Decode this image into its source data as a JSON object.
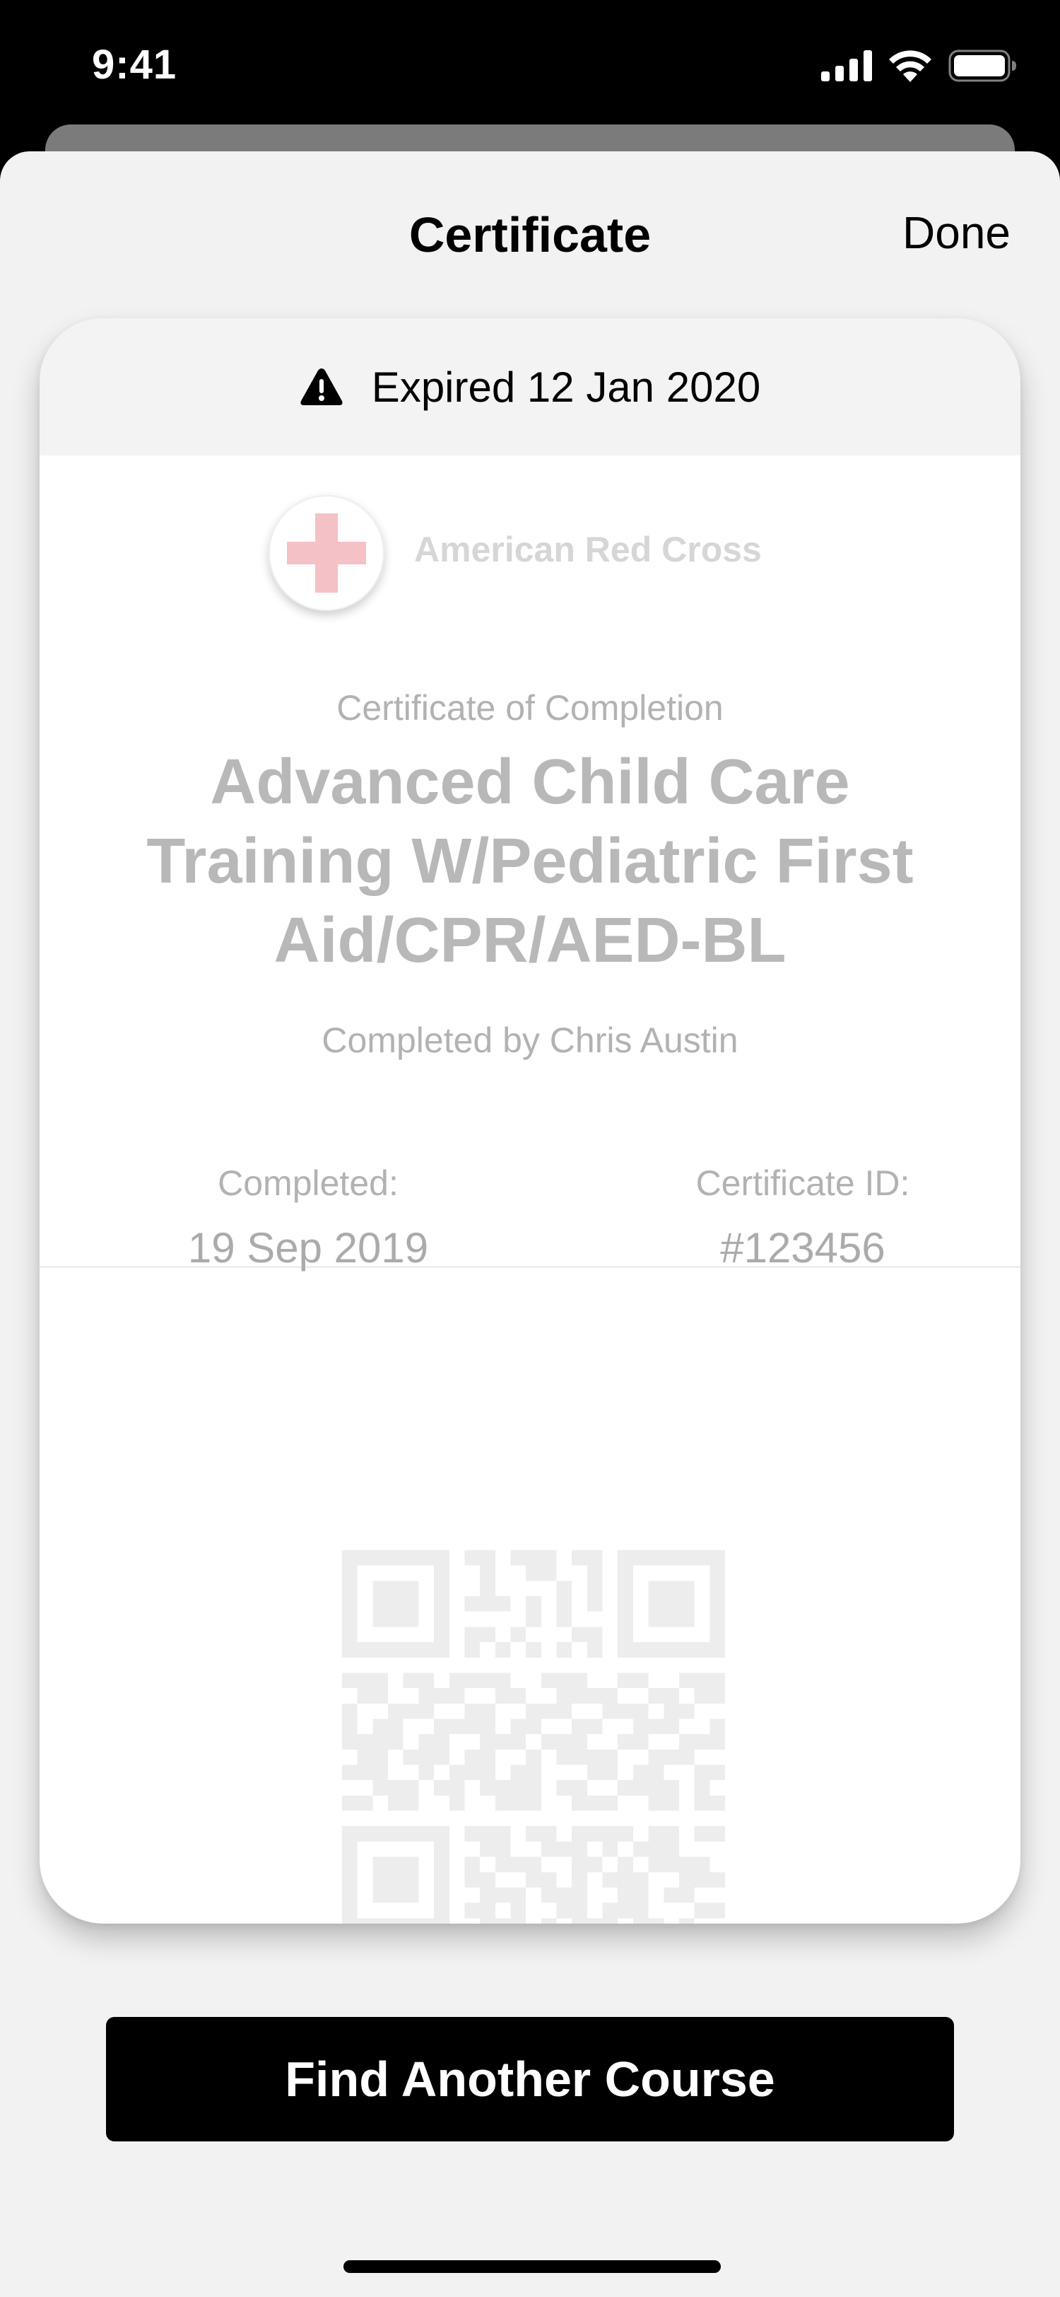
{
  "status_bar": {
    "time": "9:41",
    "icons": [
      "cellular-signal-icon",
      "wifi-icon",
      "battery-icon"
    ]
  },
  "nav": {
    "title": "Certificate",
    "done_label": "Done"
  },
  "certificate": {
    "expired_label": "Expired 12 Jan 2020",
    "expired_icon": "warning-icon",
    "org_name": "American Red Cross",
    "org_logo": "red-cross-logo",
    "subtitle": "Certificate of Completion",
    "course_title": "Advanced Child Care Training W/Pediatric First Aid/CPR/AED-BL",
    "completed_by": "Completed by Chris Austin",
    "completed_label": "Completed:",
    "completed_date": "19 Sep 2019",
    "id_label": "Certificate ID:",
    "id_value": "#123456",
    "qr_icon": "qr-code"
  },
  "actions": {
    "find_course_label": "Find Another Course"
  },
  "colors": {
    "background": "#f2f2f2",
    "card": "#ffffff",
    "button": "#000000",
    "cross": "#f4c1c6",
    "faded_text": "#b8b8b8"
  }
}
